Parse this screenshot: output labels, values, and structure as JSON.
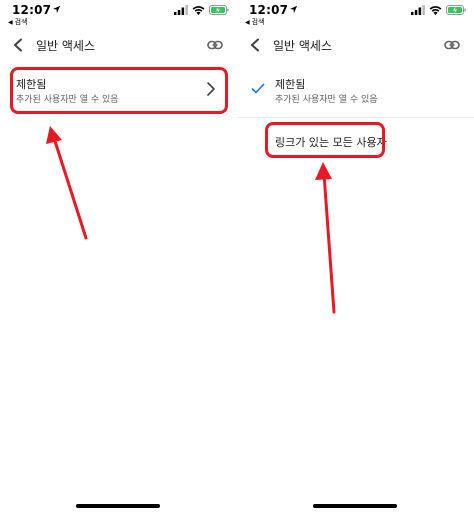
{
  "status_bar": {
    "time": "12:07",
    "back_label": "검색"
  },
  "header": {
    "title": "일반 액세스"
  },
  "options": {
    "restricted": {
      "title": "제한됨",
      "subtitle": "추가된 사용자만 열 수 있음"
    },
    "anyone_with_link": {
      "title": "링크가 있는 모든 사용자"
    }
  },
  "icons": {
    "back": "chevron-left-icon",
    "link": "link-icon",
    "chevron": "chevron-right-icon",
    "check": "check-icon"
  },
  "colors": {
    "highlight": "#e51a24",
    "check": "#1a73e8",
    "battery": "#34c759"
  }
}
